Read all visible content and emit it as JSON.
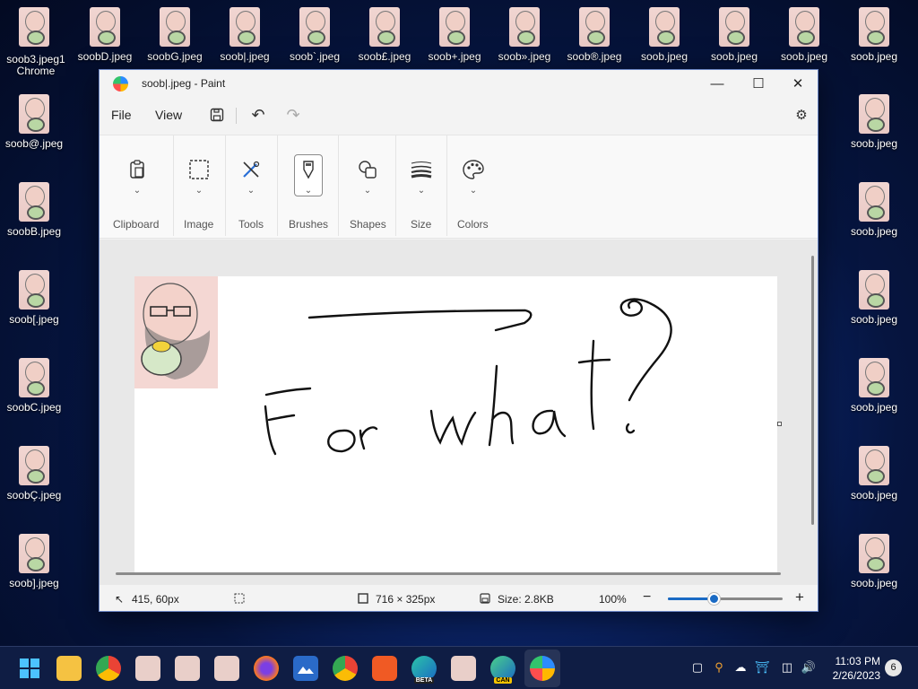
{
  "desktop": {
    "top_row": [
      "soob3.jpeg",
      "soobD.jpeg",
      "soobG.jpeg",
      "soob|.jpeg",
      "soob`.jpeg",
      "soob£.jpeg",
      "soob+.jpeg",
      "soob».jpeg",
      "soob®.jpeg",
      "soob.jpeg",
      "soob.jpeg",
      "soob.jpeg",
      "soob.jpeg"
    ],
    "top_left_overlay": [
      "soob3.jpeg1",
      "Chrome"
    ],
    "left_col": [
      "soob@.jpeg",
      "soobB.jpeg",
      "soob[.jpeg",
      "soobC.jpeg",
      "soobÇ.jpeg",
      "soob].jpeg"
    ],
    "right_col": [
      "soob.jpeg",
      "soob.jpeg",
      "soob.jpeg",
      "soob.jpeg",
      "soob.jpeg",
      "soob.jpeg"
    ]
  },
  "window": {
    "title": "soob|.jpeg - Paint",
    "menu": {
      "file": "File",
      "view": "View"
    },
    "ribbon": {
      "clipboard": "Clipboard",
      "image": "Image",
      "tools": "Tools",
      "brushes": "Brushes",
      "shapes": "Shapes",
      "size": "Size",
      "colors": "Colors"
    },
    "canvas_text": "For what?",
    "status": {
      "cursor": "415, 60px",
      "canvas_size": "716 × 325px",
      "file_size": "Size: 2.8KB",
      "zoom": "100%",
      "zoom_fraction": 0.4
    }
  },
  "taskbar": {
    "time": "11:03 PM",
    "date": "2/26/2023",
    "notifications": "6",
    "beta_label": "BETA",
    "can_label": "CAN"
  },
  "colors": {
    "accent": "#1a6ac4",
    "taskbar": "#0f1d44"
  }
}
